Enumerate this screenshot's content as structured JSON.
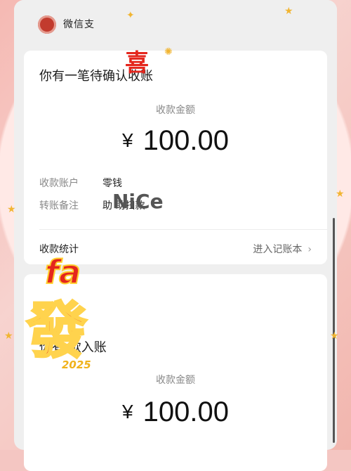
{
  "header": {
    "title": "微信支"
  },
  "cards": [
    {
      "notice": "你有一笔待确认收账",
      "amount_label": "收款金额",
      "currency": "¥",
      "amount": "100.00",
      "account_label": "收款账户",
      "account_value": "零钱",
      "remark_label": "转账备注",
      "remark_value": "助          助扫款",
      "stats_label": "收款统计",
      "ledger_link": "进入记账本"
    },
    {
      "notice": "你有            款入账",
      "amount_label": "收款金额",
      "currency": "¥",
      "amount": "100.00"
    }
  ],
  "stickers": {
    "xi": "喜",
    "fa_small": "fa",
    "fa_big": "發",
    "year": "2025",
    "nice": "NiCe"
  },
  "colors": {
    "accent_red": "#e4261d",
    "gold": "#f0b21a",
    "frame_pink": "#f4c6c2"
  },
  "icons": {
    "app_logo": "wechat-pay-logo-icon",
    "chevron": "chevron-right-icon"
  }
}
